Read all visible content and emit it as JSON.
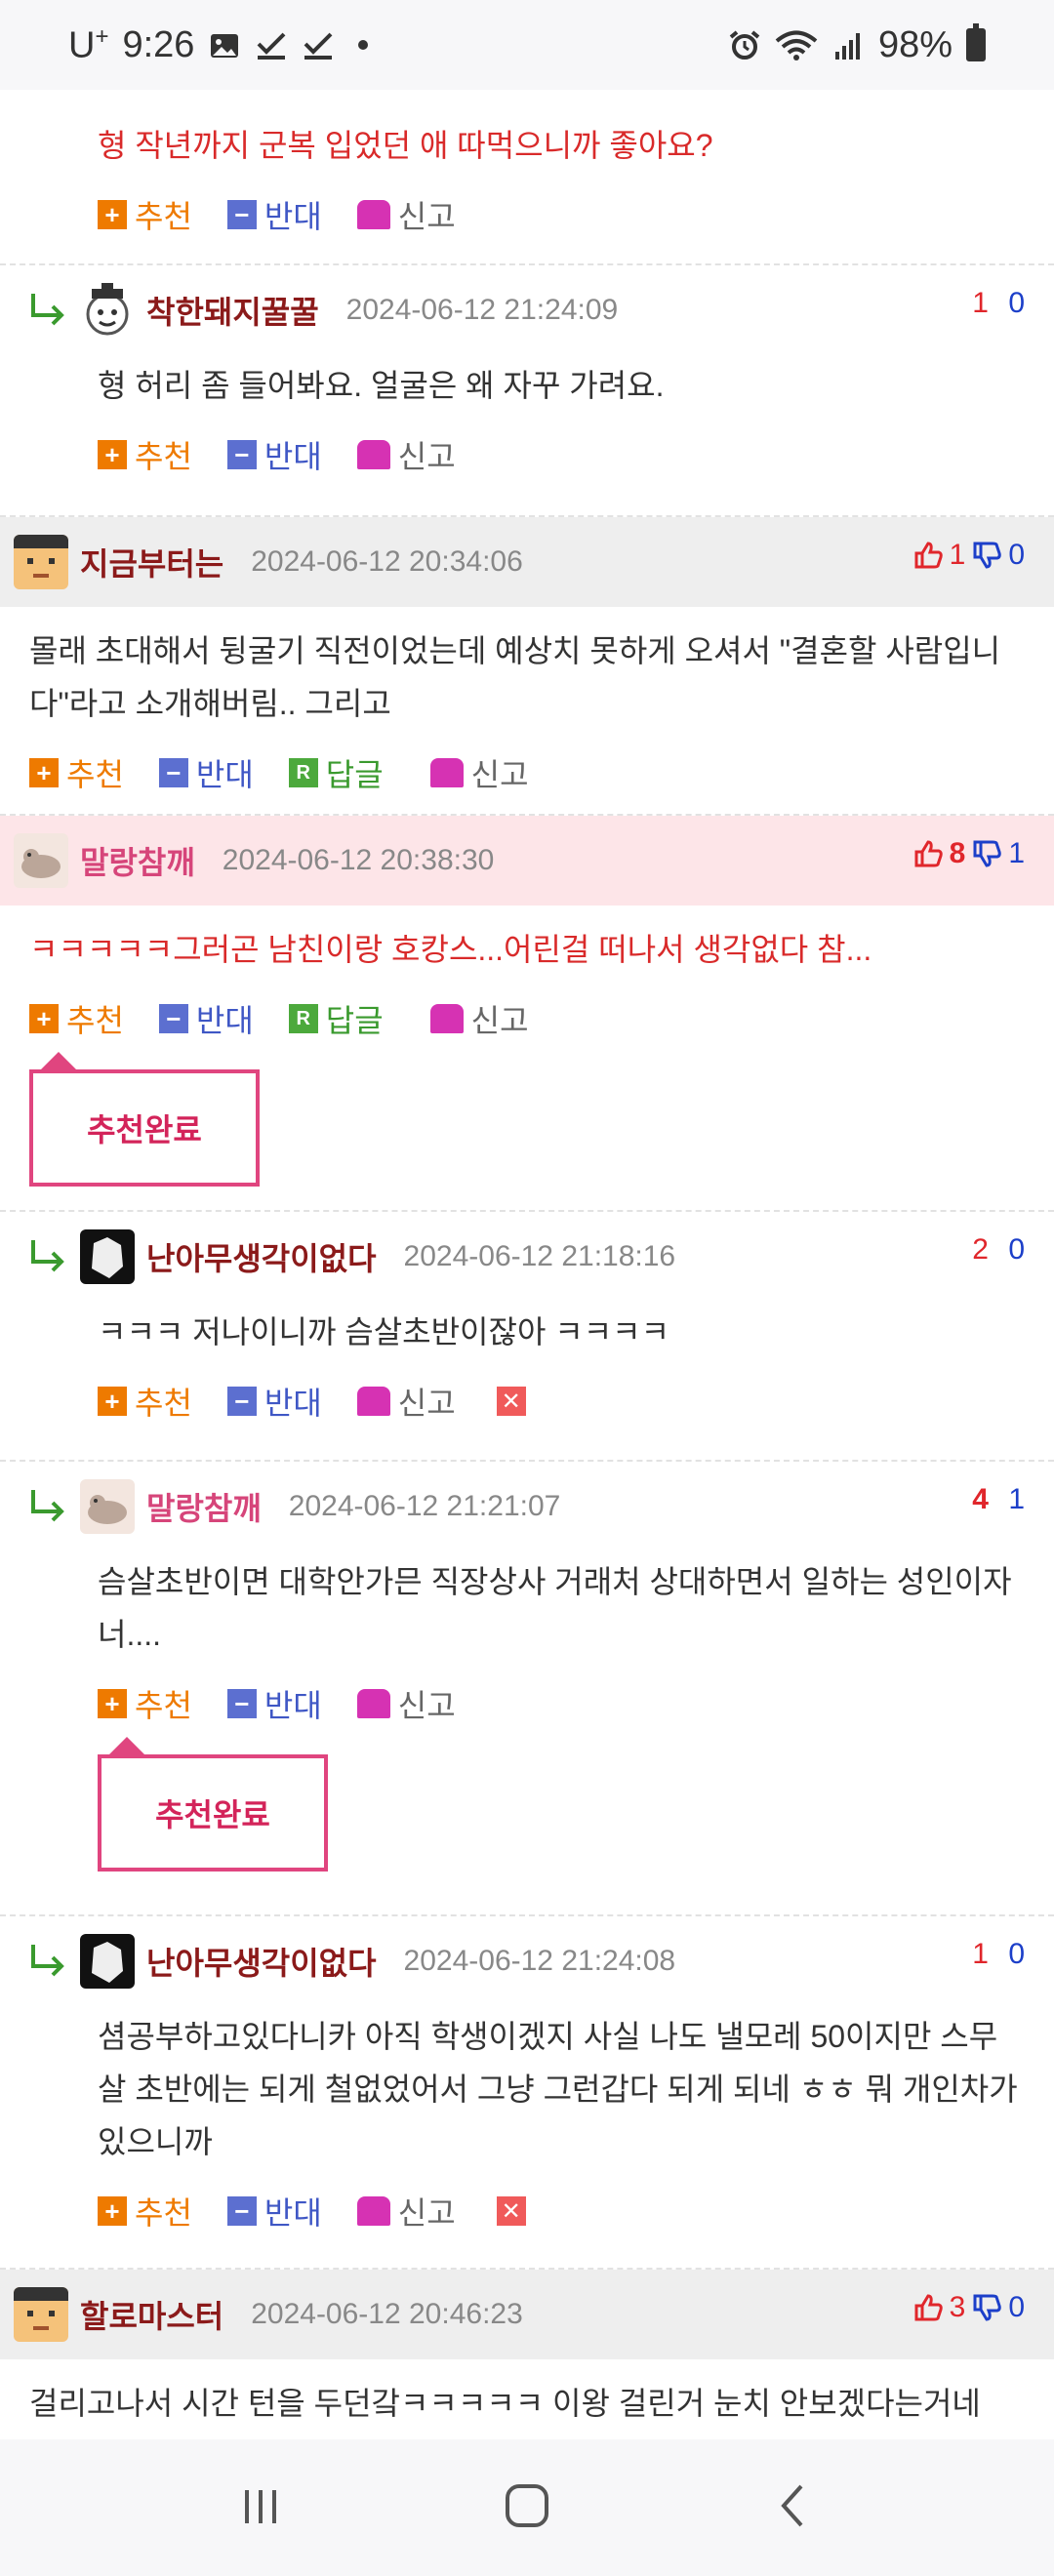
{
  "status": {
    "carrier": "U",
    "carrier_sup": "+",
    "time": "9:26",
    "battery": "98%"
  },
  "actions": {
    "recommend": "추천",
    "oppose": "반대",
    "reply": "답글",
    "report": "신고",
    "recommend_done": "추천완료"
  },
  "comments": [
    {
      "body": "형 작년까지 군복 입었던 애 따먹으니까 좋아요?"
    },
    {
      "nick": "착한돼지꿀꿀",
      "date": "2024-06-12 21:24:09",
      "up": "1",
      "down": "0",
      "body": "형 허리 좀 들어봐요. 얼굴은 왜 자꾸 가려요."
    },
    {
      "nick": "지금부터는",
      "date": "2024-06-12 20:34:06",
      "up": "1",
      "down": "0",
      "body": "몰래 초대해서 뒹굴기 직전이었는데 예상치 못하게 오셔서 \"결혼할 사람입니다\"라고 소개해버림.. 그리고"
    },
    {
      "nick": "말랑참깨",
      "date": "2024-06-12 20:38:30",
      "up": "8",
      "down": "1",
      "body": "ㅋㅋㅋㅋㅋ그러곤 남친이랑 호캉스...어린걸 떠나서 생각없다 참..."
    },
    {
      "nick": "난아무생각이없다",
      "date": "2024-06-12 21:18:16",
      "up": "2",
      "down": "0",
      "body": "ㅋㅋㅋ 저나이니까 슴살초반이잖아 ㅋㅋㅋㅋ"
    },
    {
      "nick": "말랑참깨",
      "date": "2024-06-12 21:21:07",
      "up": "4",
      "down": "1",
      "body": "슴살초반이면 대학안가믄 직장상사 거래처 상대하면서 일하는 성인이자너...."
    },
    {
      "nick": "난아무생각이없다",
      "date": "2024-06-12 21:24:08",
      "up": "1",
      "down": "0",
      "body": "셤공부하고있다니카 아직 학생이겠지 사실 나도 낼모레 50이지만 스무살 초반에는 되게 철없었어서 그냥 그런갑다 되게 되네 ㅎㅎ 뭐 개인차가 있으니까"
    },
    {
      "nick": "할로마스터",
      "date": "2024-06-12 20:46:23",
      "up": "3",
      "down": "0",
      "body": "걸리고나서 시간 턴을 두던갘ㅋㅋㅋㅋㅋ 이왕 걸린거 눈치 안보겠다는거네"
    }
  ],
  "colors": {
    "recommend": "#ee7a00",
    "oppose": "#3f57c5",
    "reply": "#3a9a2e",
    "report": "#d632b3",
    "score_up": "#e0262b",
    "score_down": "#1c3fc9",
    "highlight_row": "#fde5e8",
    "gray_row": "#eeeeee"
  }
}
